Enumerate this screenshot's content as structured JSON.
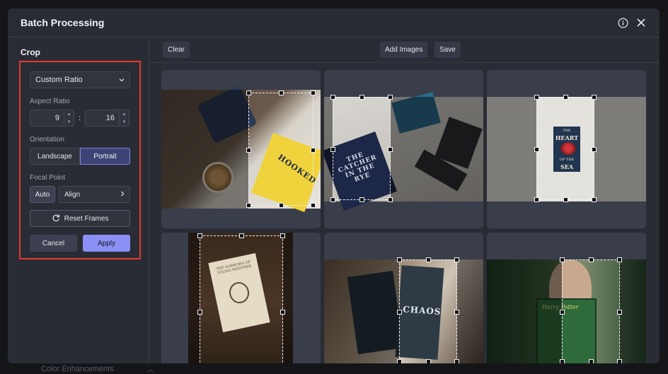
{
  "backdrop": {
    "label": "Color Enhancements"
  },
  "dialog": {
    "title": "Batch Processing",
    "info_icon": "info-icon",
    "close_icon": "close-icon"
  },
  "crop": {
    "section_title": "Crop",
    "ratio_select": "Custom Ratio",
    "aspect_label": "Aspect Ratio",
    "aspect_w": "9",
    "aspect_separator": ":",
    "aspect_h": "16",
    "orientation_label": "Orientation",
    "orientation_options": [
      "Landscape",
      "Portrait"
    ],
    "orientation_selected": "Portrait",
    "focal_label": "Focal Point",
    "focal_auto": "Auto",
    "focal_align": "Align",
    "reset_label": "Reset Frames",
    "cancel_label": "Cancel",
    "apply_label": "Apply",
    "highlight_color": "#e53a2f",
    "accent_color": "#8a90f5"
  },
  "toolbar": {
    "clear": "Clear",
    "add_images": "Add Images",
    "save": "Save"
  },
  "images": {
    "book1": "HOOKED",
    "book2": "THE CATCHER IN THE RYE",
    "book3_top": "THE",
    "book3_title": "HEART",
    "book3_mid": "OF THE",
    "book3_end": "SEA",
    "book4": "THE SORROWS OF YOUNG WERTHER",
    "book5": "CHAOS",
    "book6": "Harry Potter"
  }
}
